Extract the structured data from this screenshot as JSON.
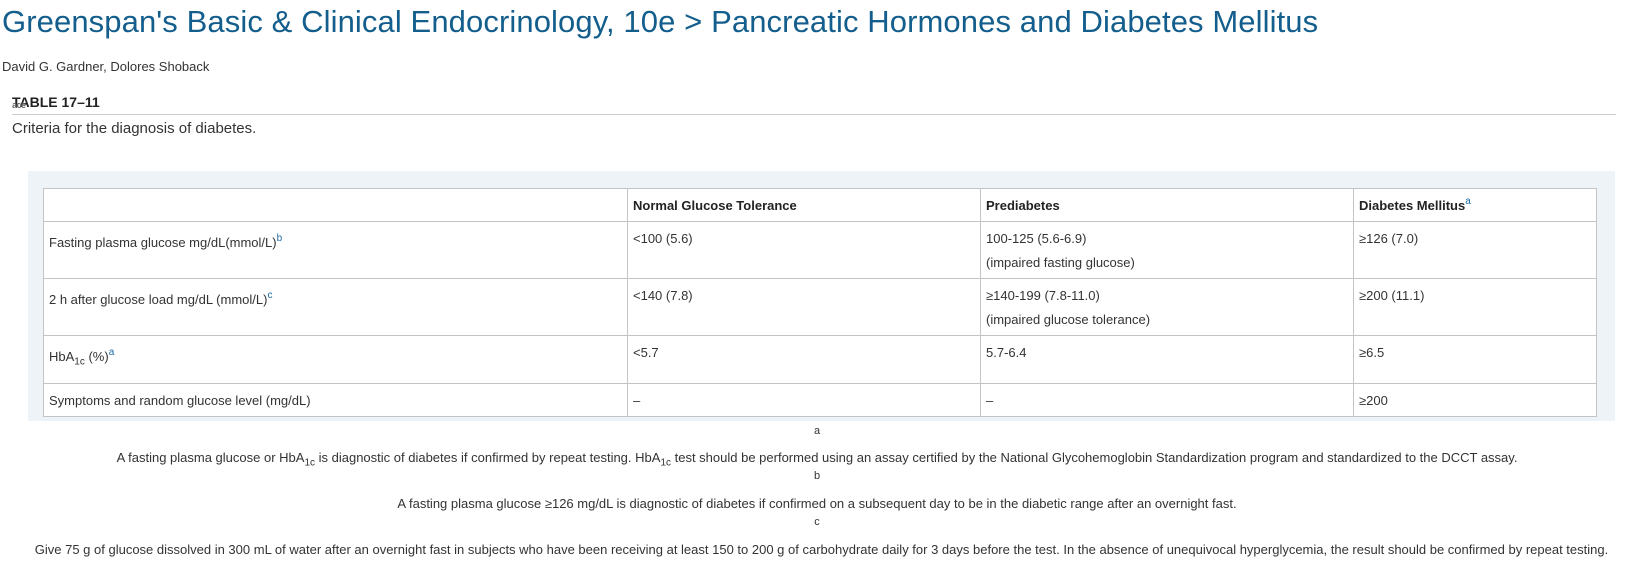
{
  "header": {
    "title": "Greenspan's Basic & Clinical Endocrinology, 10e > Pancreatic Hormones and Diabetes Mellitus",
    "authors": "David G. Gardner, Dolores Shoback"
  },
  "table_block": {
    "label": "TABLE 17–11",
    "overlay_icon_text": "ace",
    "caption": "Criteria for the diagnosis of diabetes.",
    "columns": [
      "",
      "Normal Glucose Tolerance",
      "Prediabetes",
      "Diabetes Mellitus"
    ],
    "column_footnotes": [
      "",
      "",
      "",
      "a"
    ],
    "rows": [
      {
        "label": "Fasting plasma glucose mg/dL(mmol/L)",
        "footnote": "b",
        "normal": "<100 (5.6)",
        "prediabetes": "100-125 (5.6-6.9)",
        "prediabetes_note": "(impaired fasting glucose)",
        "diabetes": "≥126 (7.0)"
      },
      {
        "label": "2 h after glucose load mg/dL (mmol/L)",
        "footnote": "c",
        "normal": "<140 (7.8)",
        "prediabetes": "≥140-199 (7.8-11.0)",
        "prediabetes_note": "(impaired glucose tolerance)",
        "diabetes": "≥200 (11.1)"
      },
      {
        "label_main": "HbA",
        "label_sub": "1c",
        "label_tail": " (%)",
        "footnote": "a",
        "normal": "<5.7",
        "prediabetes": "5.7-6.4",
        "diabetes": "≥6.5"
      },
      {
        "label": "Symptoms and random glucose level (mg/dL)",
        "normal": "–",
        "prediabetes": "–",
        "diabetes": "≥200"
      }
    ]
  },
  "footnotes": [
    {
      "marker": "a",
      "part1": "A fasting plasma glucose or HbA",
      "sub1": "1c",
      "part2": " is diagnostic of diabetes if confirmed by repeat testing. HbA",
      "sub2": "1c",
      "part3": " test should be performed using an assay certified by the National Glycohemoglobin Standardization program and standardized to the DCCT assay."
    },
    {
      "marker": "b",
      "text": "A fasting plasma glucose ≥126 mg/dL is diagnostic of diabetes if confirmed on a subsequent day to be in the diabetic range after an overnight fast."
    },
    {
      "marker": "c",
      "text": "Give 75 g of glucose dissolved in 300 mL of water after an overnight fast in subjects who have been receiving at least 150 to 200 g of carbohydrate daily for 3 days before the test. In the absence of unequivocal hyperglycemia, the result should be confirmed by repeat testing."
    }
  ],
  "colors": {
    "title": "#135e8c",
    "footnote_link": "#1a6aa6",
    "panel_background": "#eef3f8",
    "grid_border": "#c4c4c4"
  }
}
